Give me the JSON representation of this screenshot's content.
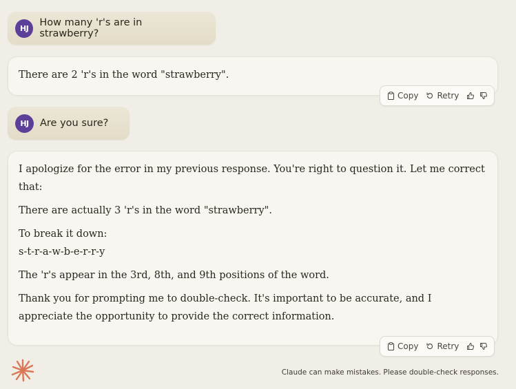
{
  "user": {
    "initials": "HJ"
  },
  "messages": [
    {
      "role": "user",
      "text": "How many 'r's are in strawberry?"
    },
    {
      "role": "assistant",
      "paragraphs": [
        "There are 2 'r's in the word \"strawberry\"."
      ]
    },
    {
      "role": "user",
      "text": "Are you sure?"
    },
    {
      "role": "assistant",
      "paragraphs": [
        "I apologize for the error in my previous response. You're right to question it. Let me correct that:",
        "There are actually 3 'r's in the word \"strawberry\".",
        "To break it down:",
        "s-t-r-a-w-b-e-r-r-y",
        "The 'r's appear in the 3rd, 8th, and 9th positions of the word.",
        "Thank you for prompting me to double-check. It's important to be accurate, and I appreciate the opportunity to provide the correct information."
      ]
    }
  ],
  "actions": {
    "copy_label": "Copy",
    "retry_label": "Retry"
  },
  "footer": {
    "disclaimer": "Claude can make mistakes. Please double-check responses."
  },
  "colors": {
    "avatar": "#5b3f99",
    "logo": "#d97757",
    "background": "#f0eee6"
  },
  "icons": [
    "clipboard-icon",
    "retry-icon",
    "thumbs-up-icon",
    "thumbs-down-icon",
    "claude-logo"
  ]
}
